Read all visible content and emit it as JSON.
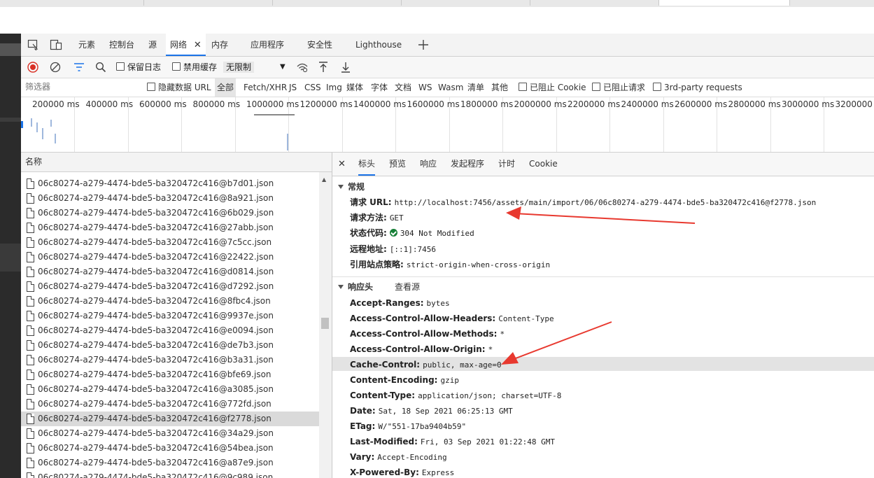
{
  "devtools_tabs": [
    "元素",
    "控制台",
    "源",
    "网络",
    "内存",
    "应用程序",
    "安全性",
    "Lighthouse"
  ],
  "toolbar": {
    "preserve_log": "保留日志",
    "disable_cache": "禁用缓存",
    "throttling": "无限制"
  },
  "filter": {
    "placeholder": "筛选器",
    "hide_data_urls": "隐藏数据 URL",
    "types": [
      "全部",
      "Fetch/XHR",
      "JS",
      "CSS",
      "Img",
      "媒体",
      "字体",
      "文档",
      "WS",
      "Wasm",
      "清单",
      "其他"
    ],
    "blocked_cookies": "已阻止 Cookie",
    "blocked_requests": "已阻止请求",
    "third_party": "3rd-party requests"
  },
  "timeline": {
    "ticks": [
      "200000 ms",
      "400000 ms",
      "600000 ms",
      "800000 ms",
      "1000000 ms",
      "1200000 ms",
      "1400000 ms",
      "1600000 ms",
      "1800000 ms",
      "2000000 ms",
      "2200000 ms",
      "2400000 ms",
      "2600000 ms",
      "2800000 ms",
      "3000000 ms",
      "3200000 ms"
    ]
  },
  "request_list": {
    "header": "名称",
    "rows": [
      "06c80274-a279-4474-bde5-ba320472c416@b7d01.json",
      "06c80274-a279-4474-bde5-ba320472c416@8a921.json",
      "06c80274-a279-4474-bde5-ba320472c416@6b029.json",
      "06c80274-a279-4474-bde5-ba320472c416@27abb.json",
      "06c80274-a279-4474-bde5-ba320472c416@7c5cc.json",
      "06c80274-a279-4474-bde5-ba320472c416@22422.json",
      "06c80274-a279-4474-bde5-ba320472c416@d0814.json",
      "06c80274-a279-4474-bde5-ba320472c416@d7292.json",
      "06c80274-a279-4474-bde5-ba320472c416@8fbc4.json",
      "06c80274-a279-4474-bde5-ba320472c416@9937e.json",
      "06c80274-a279-4474-bde5-ba320472c416@e0094.json",
      "06c80274-a279-4474-bde5-ba320472c416@de7b3.json",
      "06c80274-a279-4474-bde5-ba320472c416@b3a31.json",
      "06c80274-a279-4474-bde5-ba320472c416@bfe69.json",
      "06c80274-a279-4474-bde5-ba320472c416@a3085.json",
      "06c80274-a279-4474-bde5-ba320472c416@772fd.json",
      "06c80274-a279-4474-bde5-ba320472c416@f2778.json",
      "06c80274-a279-4474-bde5-ba320472c416@34a29.json",
      "06c80274-a279-4474-bde5-ba320472c416@54bea.json",
      "06c80274-a279-4474-bde5-ba320472c416@a87e9.json",
      "06c80274-a279-4474-bde5-ba320472c416@9c989.json"
    ],
    "selected_index": 16
  },
  "details": {
    "tabs": [
      "标头",
      "预览",
      "响应",
      "发起程序",
      "计时",
      "Cookie"
    ],
    "general": {
      "title": "常规",
      "request_url_label": "请求 URL:",
      "request_url": "http://localhost:7456/assets/main/import/06/06c80274-a279-4474-bde5-ba320472c416@f2778.json",
      "method_label": "请求方法:",
      "method": "GET",
      "status_label": "状态代码:",
      "status": "304 Not Modified",
      "remote_label": "远程地址:",
      "remote": "[::1]:7456",
      "referrer_label": "引用站点策略:",
      "referrer": "strict-origin-when-cross-origin"
    },
    "response_headers": {
      "title": "响应头",
      "view_source": "查看源",
      "items": [
        {
          "k": "Accept-Ranges:",
          "v": "bytes"
        },
        {
          "k": "Access-Control-Allow-Headers:",
          "v": "Content-Type"
        },
        {
          "k": "Access-Control-Allow-Methods:",
          "v": "*"
        },
        {
          "k": "Access-Control-Allow-Origin:",
          "v": "*"
        },
        {
          "k": "Cache-Control:",
          "v": "public, max-age=0"
        },
        {
          "k": "Content-Encoding:",
          "v": "gzip"
        },
        {
          "k": "Content-Type:",
          "v": "application/json; charset=UTF-8"
        },
        {
          "k": "Date:",
          "v": "Sat, 18 Sep 2021 06:25:13 GMT"
        },
        {
          "k": "ETag:",
          "v": "W/\"551-17ba9404b59\""
        },
        {
          "k": "Last-Modified:",
          "v": "Fri, 03 Sep 2021 01:22:48 GMT"
        },
        {
          "k": "Vary:",
          "v": "Accept-Encoding"
        },
        {
          "k": "X-Powered-By:",
          "v": "Express"
        }
      ]
    }
  },
  "colors": {
    "accent": "#1a73e8",
    "record": "#d93025",
    "annotation_arrow": "#e8392f",
    "status_ok": "#188038"
  }
}
